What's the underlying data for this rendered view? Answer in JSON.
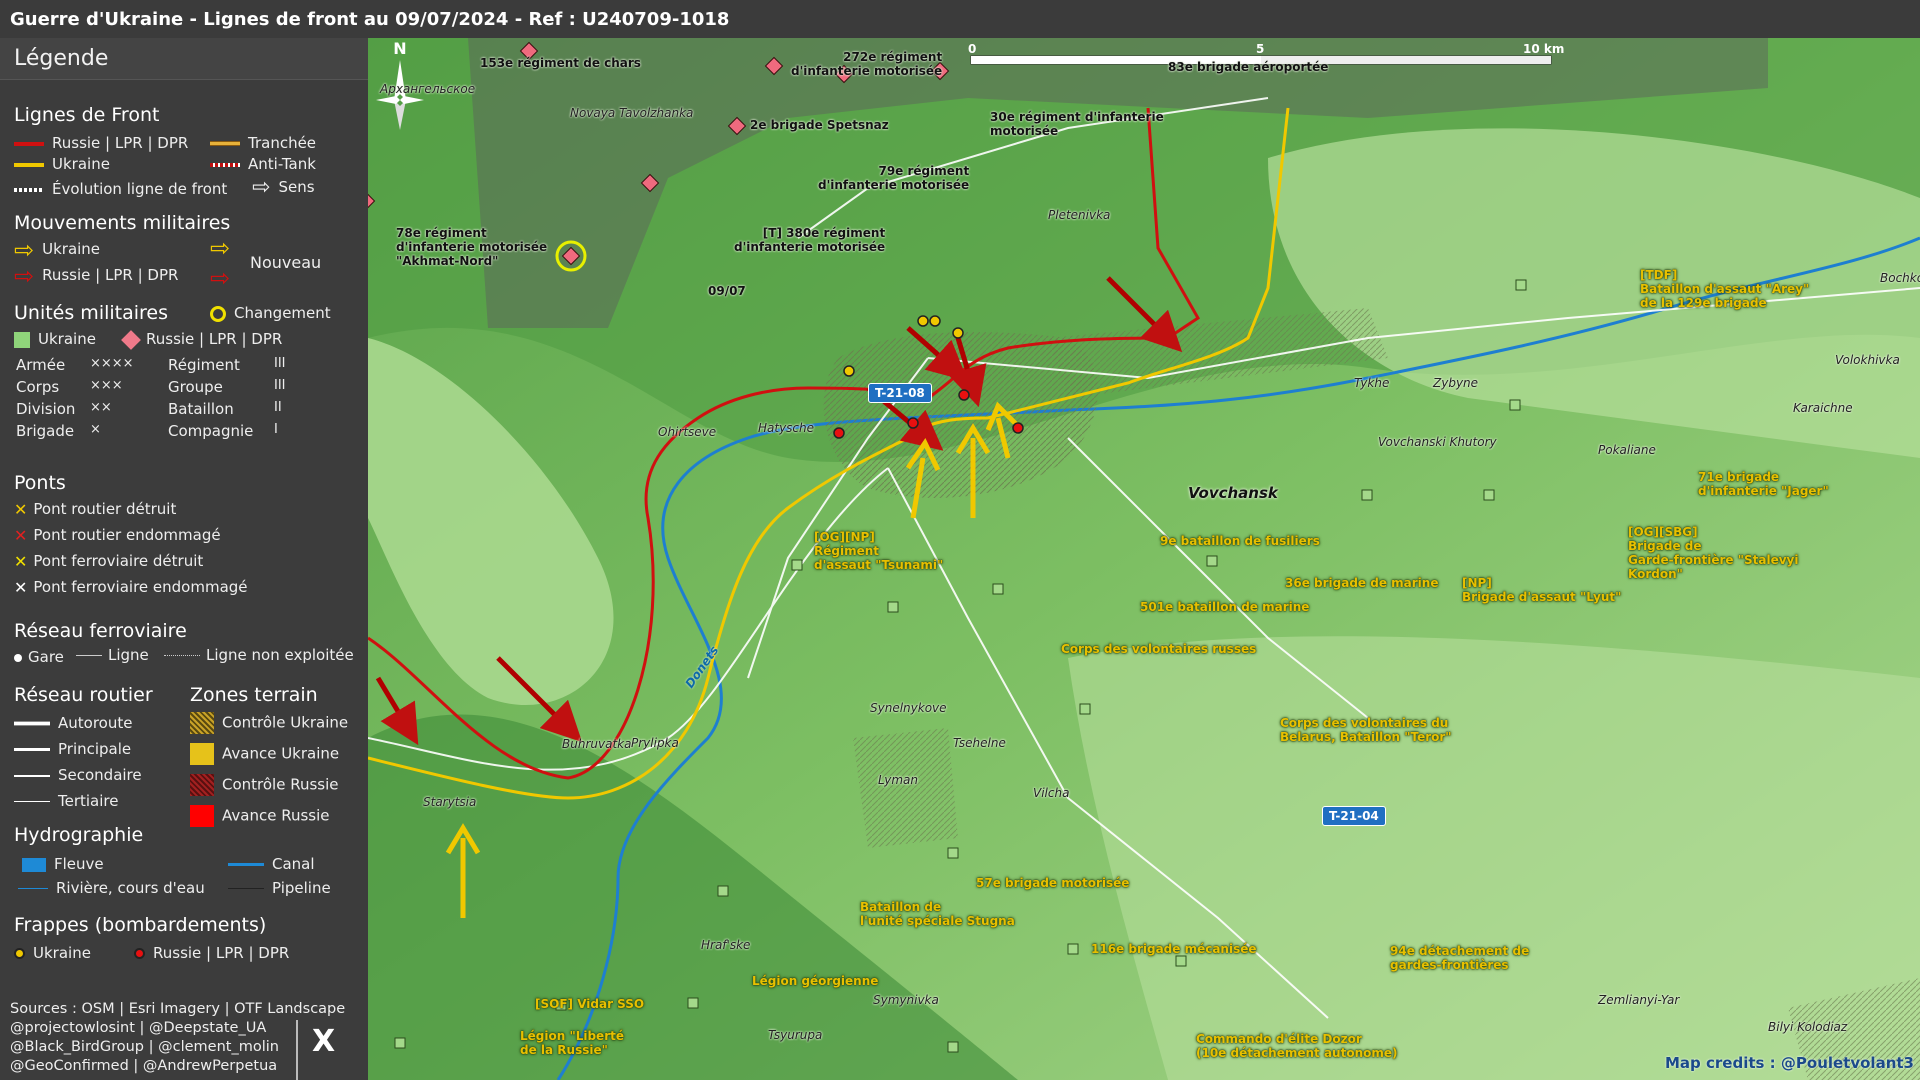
{
  "title": "Guerre d'Ukraine - Lignes de front au 09/07/2024 - Ref : U240709-1018",
  "legend": {
    "heading": "Légende",
    "front_lines": {
      "title": "Lignes de Front",
      "russia": "Russie | LPR | DPR",
      "ukraine": "Ukraine",
      "trench": "Tranchée",
      "antitank": "Anti-Tank",
      "evolution": "Évolution ligne de front",
      "direction": "Sens",
      "colors": {
        "russia": "#d01010",
        "ukraine": "#f0c800"
      }
    },
    "movements": {
      "title": "Mouvements militaires",
      "ukraine": "Ukraine",
      "russia": "Russie | LPR | DPR",
      "new": "Nouveau"
    },
    "units": {
      "title": "Unités militaires",
      "change": "Changement",
      "ukraine": "Ukraine",
      "russia": "Russie | LPR | DPR",
      "sizes": [
        {
          "label": "Armée",
          "symbol": "××××",
          "label2": "Régiment",
          "symbol2": "III"
        },
        {
          "label": "Corps",
          "symbol": "×××",
          "label2": "Groupe",
          "symbol2": "III"
        },
        {
          "label": "Division",
          "symbol": "××",
          "label2": "Bataillon",
          "symbol2": "II"
        },
        {
          "label": "Brigade",
          "symbol": "×",
          "label2": "Compagnie",
          "symbol2": "I"
        }
      ]
    },
    "bridges": {
      "title": "Ponts",
      "items": [
        {
          "label": "Pont routier détruit",
          "color": "#f0c800"
        },
        {
          "label": "Pont routier endommagé",
          "color": "#e02020"
        },
        {
          "label": "Pont ferroviaire détruit",
          "color": "#f0e000"
        },
        {
          "label": "Pont ferroviaire endommagé",
          "color": "#ffffff"
        }
      ]
    },
    "rail": {
      "title": "Réseau ferroviaire",
      "station": "Gare",
      "line": "Ligne",
      "unused": "Ligne non exploitée"
    },
    "roads": {
      "title": "Réseau routier",
      "items": [
        "Autoroute",
        "Principale",
        "Secondaire",
        "Tertiaire"
      ]
    },
    "zones": {
      "title": "Zones terrain",
      "items": [
        {
          "label": "Contrôle Ukraine",
          "color": "#c9a227"
        },
        {
          "label": "Avance Ukraine",
          "color": "#e6c21a"
        },
        {
          "label": "Contrôle Russie",
          "color": "#a32020"
        },
        {
          "label": "Avance Russie",
          "color": "#ff0000"
        }
      ]
    },
    "hydro": {
      "title": "Hydrographie",
      "river": "Fleuve",
      "canal": "Canal",
      "stream": "Rivière, cours d'eau",
      "pipeline": "Pipeline"
    },
    "strikes": {
      "title": "Frappes (bombardements)",
      "ukraine": "Ukraine",
      "russia": "Russie | LPR | DPR"
    },
    "sources": [
      "Sources : OSM | Esri Imagery | OTF Landscape",
      "@projectowlosint | @Deepstate_UA",
      "@Black_BirdGroup | @clement_molin",
      "@GeoConfirmed | @AndrewPerpetua"
    ],
    "x_logo": "X"
  },
  "scale": {
    "labels": [
      "0",
      "5",
      "10 km"
    ]
  },
  "north": "N",
  "credits": "Map credits : @Pouletvolant3",
  "roads_badges": [
    "T-21-08",
    "T-21-04"
  ],
  "places": [
    "Архангельское",
    "Novaya Tavolzhanka",
    "Pletenivka",
    "Ohirtseve",
    "Hatysche",
    "Vovchansk",
    "Tykhe",
    "Zybyne",
    "Vovchanski Khutory",
    "Pokaliane",
    "Karaichne",
    "Volokhivka",
    "Bochkove",
    "Synelnykove",
    "Tsehelne",
    "Buhruvatka",
    "Prylipka",
    "Starytsia",
    "Lyman",
    "Vilcha",
    "Hraf'ske",
    "Symynivka",
    "Tsyurupa",
    "Zemlianyi-Yar",
    "Bilyi Kolodiaz"
  ],
  "river_name": "Donets",
  "russian_units": [
    "153e régiment de chars",
    "272e régiment\nd'infanterie motorisée",
    "83e brigade aéroportée",
    "2e brigade Spetsnaz",
    "30e régiment d'infanterie\nmotorisée",
    "79e régiment\nd'infanterie motorisée",
    "78e régiment\nd'infanterie motorisée\n\"Akhmat-Nord\"",
    "[T] 380e régiment\nd'infanterie motorisée",
    "09/07"
  ],
  "ukraine_units": [
    "[TDF]\nBataillon d'assaut \"Arey\"\nde la 129e brigade",
    "71e brigade\nd'infanterie \"Jager\"",
    "[OG][SBG]\nBrigade de\nGarde-frontière \"Stalevyi\nKordon\"",
    "[NP]\nBrigade d'assaut \"Lyut\"",
    "36e brigade de marine",
    "9e bataillon de fusiliers",
    "[OG][NP]\nRégiment\nd'assaut \"Tsunami\"",
    "501e bataillon de marine",
    "Corps des volontaires russes",
    "Corps des volontaires du\nBelarus, Bataillon \"Teror\"",
    "57e brigade motorisée",
    "Bataillon de\nl'unité spéciale Stugna",
    "116e brigade mécanisée",
    "94e détachement de\ngardes-frontières",
    "Légion géorgienne",
    "[SOF] Vidar SSO",
    "Légion \"Liberté\nde la Russie\"",
    "Commando d'élite Dozor\n(10e détachement autonome)"
  ]
}
